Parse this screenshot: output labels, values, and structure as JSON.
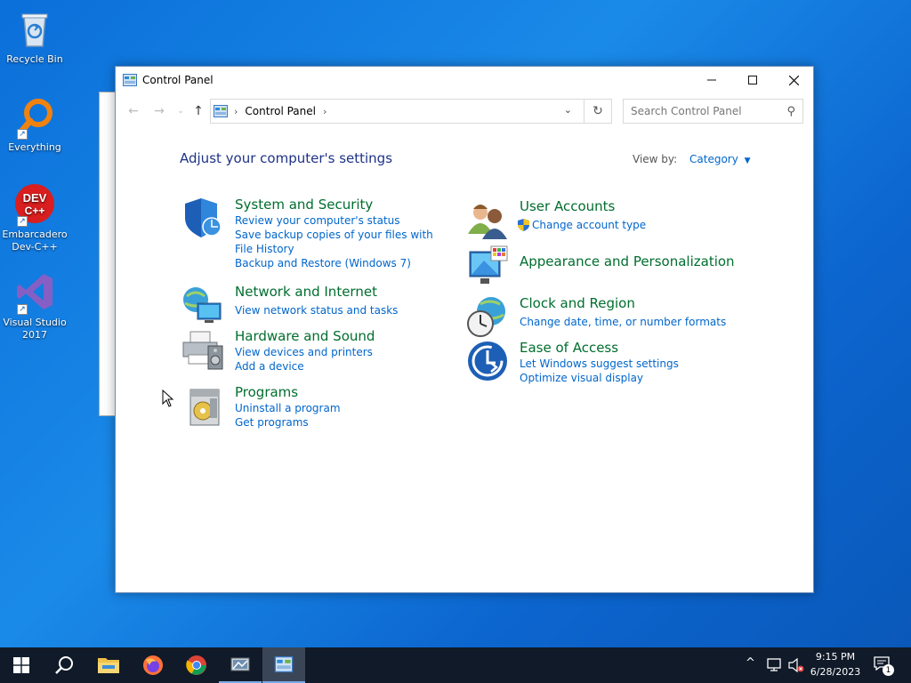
{
  "desktop": {
    "icons": [
      {
        "label": "Recycle Bin"
      },
      {
        "label": "Everything"
      },
      {
        "label": "Embarcadero Dev-C++"
      },
      {
        "label": "Visual Studio 2017"
      }
    ]
  },
  "window": {
    "title": "Control Panel",
    "address": {
      "crumb": "Control Panel"
    },
    "search": {
      "placeholder": "Search Control Panel"
    },
    "heading": "Adjust your computer's settings",
    "view_by": {
      "label": "View by:",
      "value": "Category"
    }
  },
  "categories": [
    {
      "title": "System and Security",
      "links": [
        "Review your computer's status",
        "Save backup copies of your files with File History",
        "Backup and Restore (Windows 7)"
      ]
    },
    {
      "title": "Network and Internet",
      "links": [
        "View network status and tasks"
      ]
    },
    {
      "title": "Hardware and Sound",
      "links": [
        "View devices and printers",
        "Add a device"
      ]
    },
    {
      "title": "Programs",
      "links": [
        "Uninstall a program",
        "Get programs"
      ]
    },
    {
      "title": "User Accounts",
      "links": [
        "Change account type"
      ]
    },
    {
      "title": "Appearance and Personalization",
      "links": []
    },
    {
      "title": "Clock and Region",
      "links": [
        "Change date, time, or number formats"
      ]
    },
    {
      "title": "Ease of Access",
      "links": [
        "Let Windows suggest settings",
        "Optimize visual display"
      ]
    }
  ],
  "taskbar": {
    "time": "9:15 PM",
    "date": "6/28/2023",
    "notifications_count": "1"
  },
  "colors": {
    "accent": "#0066cc",
    "category_title": "#006e2e",
    "heading": "#1e3287",
    "taskbar": "#101a29"
  }
}
